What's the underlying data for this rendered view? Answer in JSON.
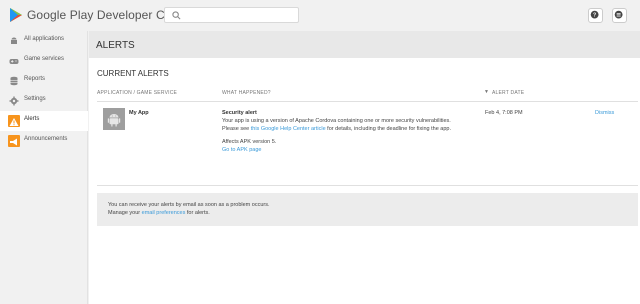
{
  "header": {
    "logo_text": "Google Play Developer Console",
    "search_placeholder": "",
    "help_icon": "help-icon",
    "account_icon": "account-icon"
  },
  "sidebar": {
    "items": [
      {
        "label": "All applications",
        "icon": "android-icon"
      },
      {
        "label": "Game services",
        "icon": "gamepad-icon"
      },
      {
        "label": "Reports",
        "icon": "database-icon"
      },
      {
        "label": "Settings",
        "icon": "gear-icon"
      },
      {
        "label": "Alerts",
        "icon": "warning-icon",
        "active": true
      },
      {
        "label": "Announcements",
        "icon": "megaphone-icon"
      }
    ]
  },
  "main": {
    "page_title": "ALERTS",
    "section_title": "CURRENT ALERTS",
    "columns": {
      "app": "APPLICATION / GAME SERVICE",
      "what": "WHAT HAPPENED?",
      "date": "ALERT DATE"
    },
    "alert": {
      "app_name": "My App",
      "title": "Security alert",
      "line1": "Your app is using a version of Apache Cordova containing one or more security vulnerabilities.",
      "line2_pre": "Please see ",
      "line2_link": "this Google Help Center article",
      "line2_post": " for details, including the deadline for fixing the app.",
      "affects": "Affects APK version 5.",
      "apk_link": "Go to APK page",
      "date": "Feb 4, 7:08 PM",
      "dismiss": "Dismiss"
    },
    "info": {
      "line1": "You can receive your alerts by email as soon as a problem occurs.",
      "line2_pre": "Manage your ",
      "line2_link": "email preferences",
      "line2_post": " for alerts."
    }
  },
  "colors": {
    "accent": "#3a9ad9",
    "alerts_icon": "#f7941d"
  }
}
